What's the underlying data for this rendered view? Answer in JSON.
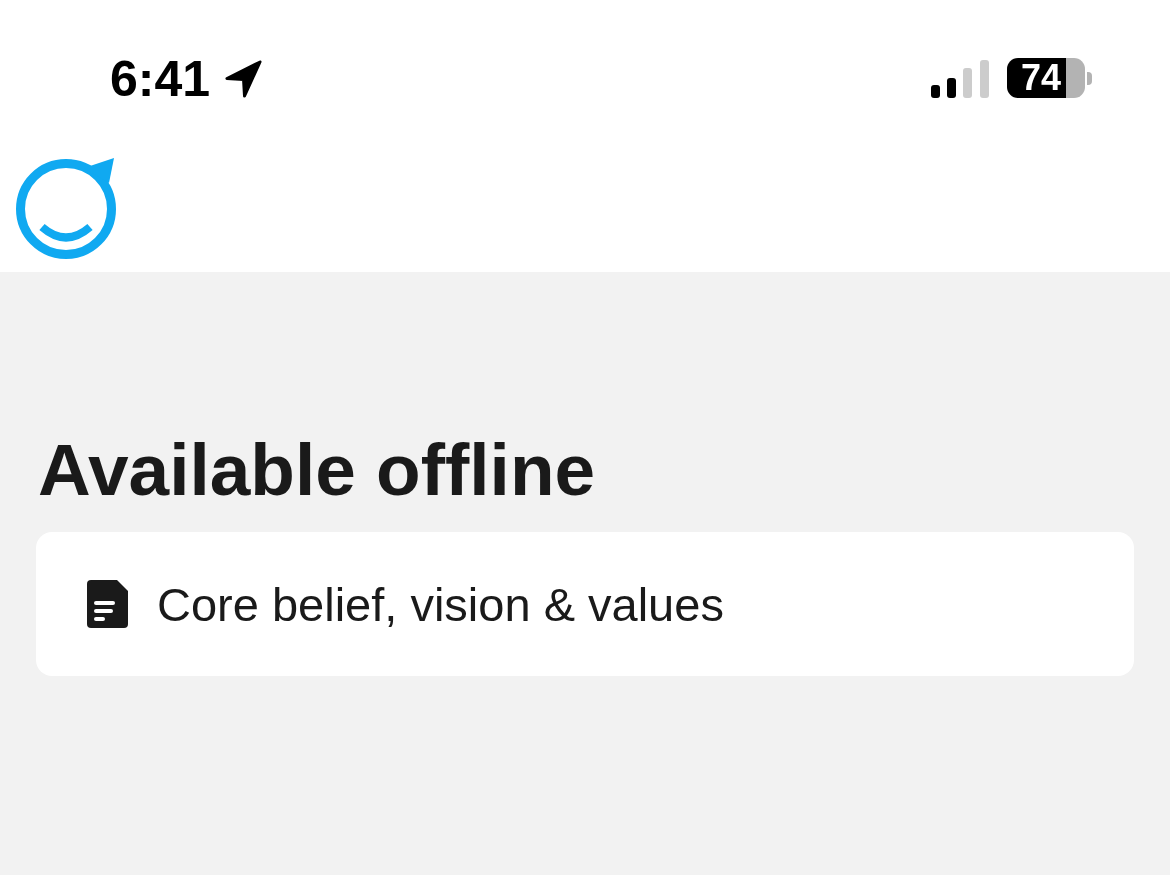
{
  "status_bar": {
    "time": "6:41",
    "battery": "74"
  },
  "offline_section": {
    "title": "Available offline",
    "items": [
      {
        "label": "Core belief, vision & values"
      }
    ]
  }
}
